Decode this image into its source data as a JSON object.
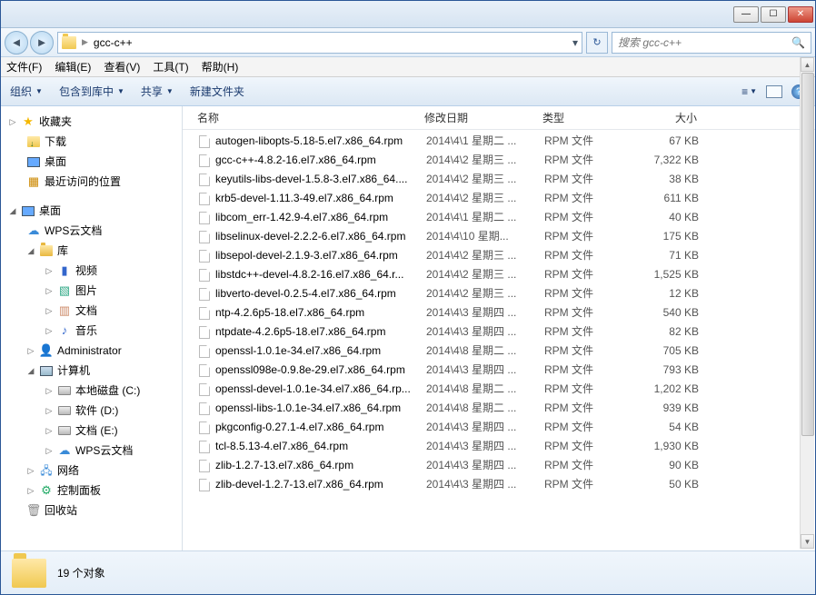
{
  "address": {
    "path": "gcc-c++"
  },
  "search": {
    "placeholder": "搜索 gcc-c++"
  },
  "menu": {
    "file": "文件(F)",
    "edit": "编辑(E)",
    "view": "查看(V)",
    "tools": "工具(T)",
    "help": "帮助(H)"
  },
  "toolbar": {
    "organize": "组织",
    "include": "包含到库中",
    "share": "共享",
    "newfolder": "新建文件夹"
  },
  "columns": {
    "name": "名称",
    "date": "修改日期",
    "type": "类型",
    "size": "大小"
  },
  "sidebar": {
    "favorites": "收藏夹",
    "downloads": "下载",
    "desktop": "桌面",
    "recent": "最近访问的位置",
    "desktop2": "桌面",
    "wpscloud": "WPS云文档",
    "library": "库",
    "video": "视频",
    "pictures": "图片",
    "documents": "文档",
    "music": "音乐",
    "admin": "Administrator",
    "computer": "计算机",
    "cdrive": "本地磁盘 (C:)",
    "ddrive": "软件 (D:)",
    "edrive": "文档 (E:)",
    "wpscloud2": "WPS云文档",
    "network": "网络",
    "control": "控制面板",
    "recycle": "回收站"
  },
  "files": [
    {
      "name": "autogen-libopts-5.18-5.el7.x86_64.rpm",
      "date": "2014\\4\\1 星期二 ...",
      "type": "RPM 文件",
      "size": "67 KB"
    },
    {
      "name": "gcc-c++-4.8.2-16.el7.x86_64.rpm",
      "date": "2014\\4\\2 星期三 ...",
      "type": "RPM 文件",
      "size": "7,322 KB"
    },
    {
      "name": "keyutils-libs-devel-1.5.8-3.el7.x86_64....",
      "date": "2014\\4\\2 星期三 ...",
      "type": "RPM 文件",
      "size": "38 KB"
    },
    {
      "name": "krb5-devel-1.11.3-49.el7.x86_64.rpm",
      "date": "2014\\4\\2 星期三 ...",
      "type": "RPM 文件",
      "size": "611 KB"
    },
    {
      "name": "libcom_err-1.42.9-4.el7.x86_64.rpm",
      "date": "2014\\4\\1 星期二 ...",
      "type": "RPM 文件",
      "size": "40 KB"
    },
    {
      "name": "libselinux-devel-2.2.2-6.el7.x86_64.rpm",
      "date": "2014\\4\\10 星期...",
      "type": "RPM 文件",
      "size": "175 KB"
    },
    {
      "name": "libsepol-devel-2.1.9-3.el7.x86_64.rpm",
      "date": "2014\\4\\2 星期三 ...",
      "type": "RPM 文件",
      "size": "71 KB"
    },
    {
      "name": "libstdc++-devel-4.8.2-16.el7.x86_64.r...",
      "date": "2014\\4\\2 星期三 ...",
      "type": "RPM 文件",
      "size": "1,525 KB"
    },
    {
      "name": "libverto-devel-0.2.5-4.el7.x86_64.rpm",
      "date": "2014\\4\\2 星期三 ...",
      "type": "RPM 文件",
      "size": "12 KB"
    },
    {
      "name": "ntp-4.2.6p5-18.el7.x86_64.rpm",
      "date": "2014\\4\\3 星期四 ...",
      "type": "RPM 文件",
      "size": "540 KB"
    },
    {
      "name": "ntpdate-4.2.6p5-18.el7.x86_64.rpm",
      "date": "2014\\4\\3 星期四 ...",
      "type": "RPM 文件",
      "size": "82 KB"
    },
    {
      "name": "openssl-1.0.1e-34.el7.x86_64.rpm",
      "date": "2014\\4\\8 星期二 ...",
      "type": "RPM 文件",
      "size": "705 KB"
    },
    {
      "name": "openssl098e-0.9.8e-29.el7.x86_64.rpm",
      "date": "2014\\4\\3 星期四 ...",
      "type": "RPM 文件",
      "size": "793 KB"
    },
    {
      "name": "openssl-devel-1.0.1e-34.el7.x86_64.rp...",
      "date": "2014\\4\\8 星期二 ...",
      "type": "RPM 文件",
      "size": "1,202 KB"
    },
    {
      "name": "openssl-libs-1.0.1e-34.el7.x86_64.rpm",
      "date": "2014\\4\\8 星期二 ...",
      "type": "RPM 文件",
      "size": "939 KB"
    },
    {
      "name": "pkgconfig-0.27.1-4.el7.x86_64.rpm",
      "date": "2014\\4\\3 星期四 ...",
      "type": "RPM 文件",
      "size": "54 KB"
    },
    {
      "name": "tcl-8.5.13-4.el7.x86_64.rpm",
      "date": "2014\\4\\3 星期四 ...",
      "type": "RPM 文件",
      "size": "1,930 KB"
    },
    {
      "name": "zlib-1.2.7-13.el7.x86_64.rpm",
      "date": "2014\\4\\3 星期四 ...",
      "type": "RPM 文件",
      "size": "90 KB"
    },
    {
      "name": "zlib-devel-1.2.7-13.el7.x86_64.rpm",
      "date": "2014\\4\\3 星期四 ...",
      "type": "RPM 文件",
      "size": "50 KB"
    }
  ],
  "status": {
    "count": "19 个对象"
  }
}
